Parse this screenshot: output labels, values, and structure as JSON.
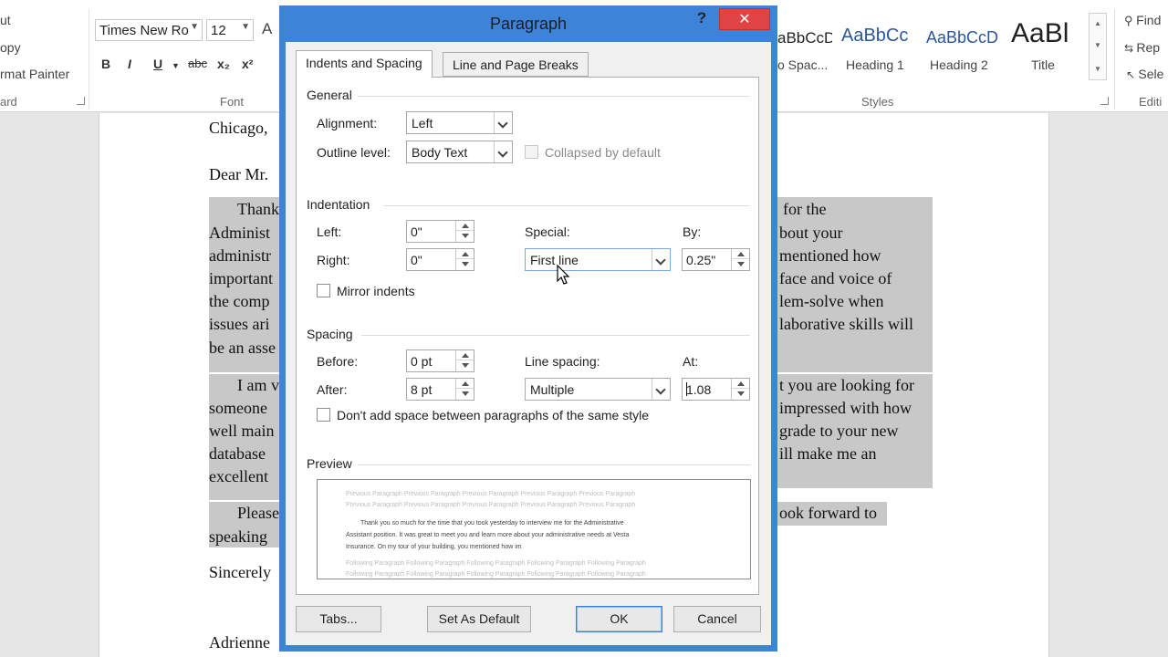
{
  "ribbon": {
    "clipboard": {
      "cut": "ut",
      "copy": "opy",
      "format_painter": "rmat Painter",
      "group_label": "ard"
    },
    "font": {
      "name": "Times New Ro",
      "size": "12",
      "group_label": "Font",
      "grow_glyph": "A",
      "bold": "B",
      "italic": "I",
      "underline": "U",
      "strike": "abc",
      "sub": "x₂",
      "sup": "x²"
    },
    "styles": {
      "group_label": "Styles",
      "items": [
        {
          "preview": "aBbCcDc",
          "name": "o Spac..."
        },
        {
          "preview": "AaBbCc",
          "name": "Heading 1"
        },
        {
          "preview": "AaBbCcD",
          "name": "Heading 2"
        },
        {
          "preview": "AaBl",
          "name": "Title"
        }
      ]
    },
    "editing": {
      "find": "Find",
      "replace": "Rep",
      "select": "Sele",
      "group_label": "Editi"
    }
  },
  "document": {
    "left_lines": [
      "Chicago,",
      "Dear Mr.",
      "Thank",
      "Administ",
      "administr",
      "important",
      "the comp",
      "issues ari",
      "be an asse",
      "I am v",
      "someone",
      "well main",
      "database",
      "excellent",
      "Please",
      "speaking",
      "Sincerely",
      "Adrienne"
    ],
    "right_lines": [
      "for the",
      "bout your",
      "mentioned how",
      "face and voice of",
      "lem-solve when",
      "laborative skills will",
      "t you are looking for",
      "impressed with how",
      "grade to your new",
      "ill make me an",
      "ook forward to"
    ]
  },
  "dialog": {
    "title": "Paragraph",
    "help": "?",
    "close": "✕",
    "tabs": [
      "Indents and Spacing",
      "Line and Page Breaks"
    ],
    "general": {
      "title": "General",
      "alignment_label": "Alignment:",
      "alignment_value": "Left",
      "outline_label": "Outline level:",
      "outline_value": "Body Text",
      "collapsed_label": "Collapsed by default"
    },
    "indentation": {
      "title": "Indentation",
      "left_label": "Left:",
      "left_value": "0\"",
      "right_label": "Right:",
      "right_value": "0\"",
      "special_label": "Special:",
      "special_value": "First line",
      "by_label": "By:",
      "by_value": "0.25\"",
      "mirror_label": "Mirror indents"
    },
    "spacing": {
      "title": "Spacing",
      "before_label": "Before:",
      "before_value": "0 pt",
      "after_label": "After:",
      "after_value": "8 pt",
      "line_spacing_label": "Line spacing:",
      "line_spacing_value": "Multiple",
      "at_label": "At:",
      "at_value": "1.08",
      "dont_add_label": "Don't add space between paragraphs of the same style"
    },
    "preview": {
      "title": "Preview",
      "prev_lines": [
        "Previous Paragraph Previous Paragraph Previous Paragraph Previous Paragraph Previous Paragraph",
        "Previous Paragraph Previous Paragraph Previous Paragraph Previous Paragraph Previous Paragraph"
      ],
      "sample_lines": [
        "Thank you so much for the time that you took yesterday to interview me for the Administrative",
        "Assistant position. It was great to meet you and learn more about your administrative needs at Vesta",
        "Insurance. On my tour of your building, you mentioned how im"
      ],
      "next_lines": [
        "Following Paragraph Following Paragraph Following Paragraph Following Paragraph Following Paragraph",
        "Following Paragraph Following Paragraph Following Paragraph Following Paragraph Following Paragraph"
      ]
    },
    "buttons": {
      "tabs": "Tabs...",
      "set_default": "Set As Default",
      "ok": "OK",
      "cancel": "Cancel"
    }
  },
  "colors": {
    "dialog_frame": "#3d83d8",
    "close_red": "#e04343",
    "style_blue": "#2b579a",
    "highlight": "#c8c8c8"
  }
}
